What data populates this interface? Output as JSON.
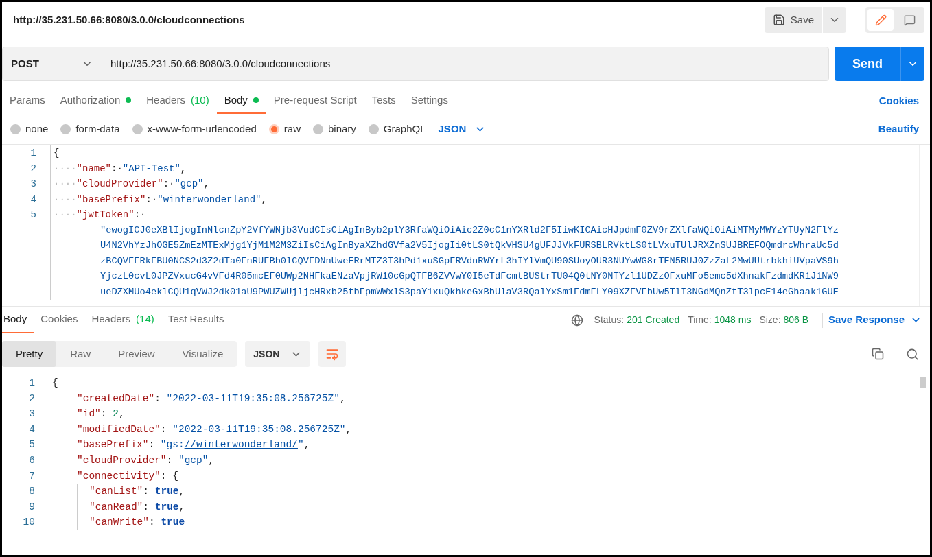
{
  "header": {
    "title": "http://35.231.50.66:8080/3.0.0/cloudconnections",
    "save_label": "Save"
  },
  "request": {
    "method": "POST",
    "url": "http://35.231.50.66:8080/3.0.0/cloudconnections",
    "send_label": "Send"
  },
  "request_tabs": [
    {
      "label": "Params",
      "selected": false
    },
    {
      "label": "Authorization",
      "dot": true,
      "selected": false
    },
    {
      "label": "Headers",
      "count": "(10)",
      "selected": false
    },
    {
      "label": "Body",
      "dot": true,
      "selected": true
    },
    {
      "label": "Pre-request Script",
      "selected": false
    },
    {
      "label": "Tests",
      "selected": false
    },
    {
      "label": "Settings",
      "selected": false
    }
  ],
  "cookies_link": "Cookies",
  "body_types": [
    {
      "label": "none",
      "selected": false
    },
    {
      "label": "form-data",
      "selected": false
    },
    {
      "label": "x-www-form-urlencoded",
      "selected": false
    },
    {
      "label": "raw",
      "selected": true
    },
    {
      "label": "binary",
      "selected": false
    },
    {
      "label": "GraphQL",
      "selected": false
    }
  ],
  "body_format": "JSON",
  "beautify_link": "Beautify",
  "request_editor": {
    "lines": [
      {
        "number": "1",
        "tokens": [
          {
            "kind": "punct",
            "text": "{"
          }
        ]
      },
      {
        "number": "2",
        "indent": "····",
        "tokens": [
          {
            "kind": "key",
            "text": "\"name\""
          },
          {
            "kind": "punct",
            "text": ":·"
          },
          {
            "kind": "string",
            "text": "\"API-Test\""
          },
          {
            "kind": "punct",
            "text": ","
          }
        ]
      },
      {
        "number": "3",
        "indent": "····",
        "tokens": [
          {
            "kind": "key",
            "text": "\"cloudProvider\""
          },
          {
            "kind": "punct",
            "text": ":·"
          },
          {
            "kind": "string",
            "text": "\"gcp\""
          },
          {
            "kind": "punct",
            "text": ","
          }
        ]
      },
      {
        "number": "4",
        "indent": "····",
        "tokens": [
          {
            "kind": "key",
            "text": "\"basePrefix\""
          },
          {
            "kind": "punct",
            "text": ":·"
          },
          {
            "kind": "string",
            "text": "\"winterwonderland\""
          },
          {
            "kind": "punct",
            "text": ","
          }
        ]
      },
      {
        "number": "5",
        "indent": "····",
        "tokens": [
          {
            "kind": "key",
            "text": "\"jwtToken\""
          },
          {
            "kind": "punct",
            "text": ":·"
          }
        ],
        "wrapped": [
          "\"ewogICJ0eXBlIjogInNlcnZpY2VfYWNjb3VudCIsCiAgInByb2plY3RfaWQiOiAic2Z0cC1nYXRld2F5IiwKICAicHJpdmF0ZV9rZXlfaWQiOiAiMTMyMWYzYTUyN2FlYz",
          "U4N2VhYzJhOGE5ZmEzMTExMjg1YjM1M2M3ZiIsCiAgInByaXZhdGVfa2V5IjogIi0tLS0tQkVHSU4gUFJJVkFURSBLRVktLS0tLVxuTUlJRXZnSUJBREFOQmdrcWhraUc5d",
          "zBCQVFFRkFBU0NCS2d3Z2dTa0FnRUFBb0lCQVFDNnUweERrMTZ3T3hPd1xuSGpFRVdnRWYrL3hIYlVmQU90SUoyOUR3NUYwWG8rTEN5RUJ0ZzZaL2MwUUtrbkhiUVpaVS9h",
          "YjczL0cvL0JPZVxucG4vVFd4R05mcEF0UWp2NHFkaENzaVpjRW10cGpQTFB6ZVVwY0I5eTdFcmtBUStrTU04Q0tNY0NTYzl1UDZzOFxuMFo5emc5dXhnakFzdmdKR1J1NW9",
          "ueDZXMUo4eklCQU1qVWJ2dk01aU9PWUZWUjljcHRxb25tbFpmWWxlS3paY1xuQkhkeGxBbUlaV3RQalYxSm1FdmFLY09XZFVFbUw5TlI3NGdMQnZtT3lpcE14eGhaak1GUE"
        ]
      }
    ]
  },
  "response_tabs": [
    {
      "label": "Body",
      "selected": true
    },
    {
      "label": "Cookies",
      "selected": false
    },
    {
      "label": "Headers",
      "count": "(14)",
      "selected": false
    },
    {
      "label": "Test Results",
      "selected": false
    }
  ],
  "response_status": [
    {
      "label": "Status:",
      "value": "201 Created"
    },
    {
      "label": "Time:",
      "value": "1048 ms"
    },
    {
      "label": "Size:",
      "value": "806 B"
    }
  ],
  "save_response": "Save Response",
  "view_modes": [
    {
      "label": "Pretty",
      "selected": true
    },
    {
      "label": "Raw",
      "selected": false
    },
    {
      "label": "Preview",
      "selected": false
    },
    {
      "label": "Visualize",
      "selected": false
    }
  ],
  "response_format": "JSON",
  "response_editor": {
    "lines": [
      {
        "number": "1",
        "kind": "bracket",
        "tokens": [
          {
            "kind": "punct",
            "text": "{"
          }
        ]
      },
      {
        "number": "2",
        "kind": "entry",
        "tokens": [
          {
            "kind": "key",
            "text": "\"createdDate\""
          },
          {
            "kind": "punct",
            "text": ": "
          },
          {
            "kind": "string",
            "text": "\"2022-03-11T19:35:08.256725Z\""
          },
          {
            "kind": "punct",
            "text": ","
          }
        ]
      },
      {
        "number": "3",
        "kind": "entry",
        "tokens": [
          {
            "kind": "key",
            "text": "\"id\""
          },
          {
            "kind": "punct",
            "text": ": "
          },
          {
            "kind": "number",
            "text": "2"
          },
          {
            "kind": "punct",
            "text": ","
          }
        ]
      },
      {
        "number": "4",
        "kind": "entry",
        "tokens": [
          {
            "kind": "key",
            "text": "\"modifiedDate\""
          },
          {
            "kind": "punct",
            "text": ": "
          },
          {
            "kind": "string",
            "text": "\"2022-03-11T19:35:08.256725Z\""
          },
          {
            "kind": "punct",
            "text": ","
          }
        ]
      },
      {
        "number": "5",
        "kind": "entry",
        "tokens": [
          {
            "kind": "key",
            "text": "\"basePrefix\""
          },
          {
            "kind": "punct",
            "text": ": "
          },
          {
            "kind": "string",
            "text": "\"gs:"
          },
          {
            "kind": "link",
            "text": "//winterwonderland/"
          },
          {
            "kind": "string",
            "text": "\""
          },
          {
            "kind": "punct",
            "text": ","
          }
        ]
      },
      {
        "number": "6",
        "kind": "entry",
        "tokens": [
          {
            "kind": "key",
            "text": "\"cloudProvider\""
          },
          {
            "kind": "punct",
            "text": ": "
          },
          {
            "kind": "string",
            "text": "\"gcp\""
          },
          {
            "kind": "punct",
            "text": ","
          }
        ]
      },
      {
        "number": "7",
        "kind": "entry",
        "tokens": [
          {
            "kind": "key",
            "text": "\"connectivity\""
          },
          {
            "kind": "punct",
            "text": ": {"
          }
        ]
      },
      {
        "number": "8",
        "kind": "nested",
        "tokens": [
          {
            "kind": "key",
            "text": "\"canList\""
          },
          {
            "kind": "punct",
            "text": ": "
          },
          {
            "kind": "bool",
            "text": "true"
          },
          {
            "kind": "punct",
            "text": ","
          }
        ]
      },
      {
        "number": "9",
        "kind": "nested",
        "tokens": [
          {
            "kind": "key",
            "text": "\"canRead\""
          },
          {
            "kind": "punct",
            "text": ": "
          },
          {
            "kind": "bool",
            "text": "true"
          },
          {
            "kind": "punct",
            "text": ","
          }
        ]
      },
      {
        "number": "10",
        "kind": "nested",
        "tokens": [
          {
            "kind": "key",
            "text": "\"canWrite\""
          },
          {
            "kind": "punct",
            "text": ": "
          },
          {
            "kind": "bool",
            "text": "true"
          }
        ]
      }
    ]
  }
}
